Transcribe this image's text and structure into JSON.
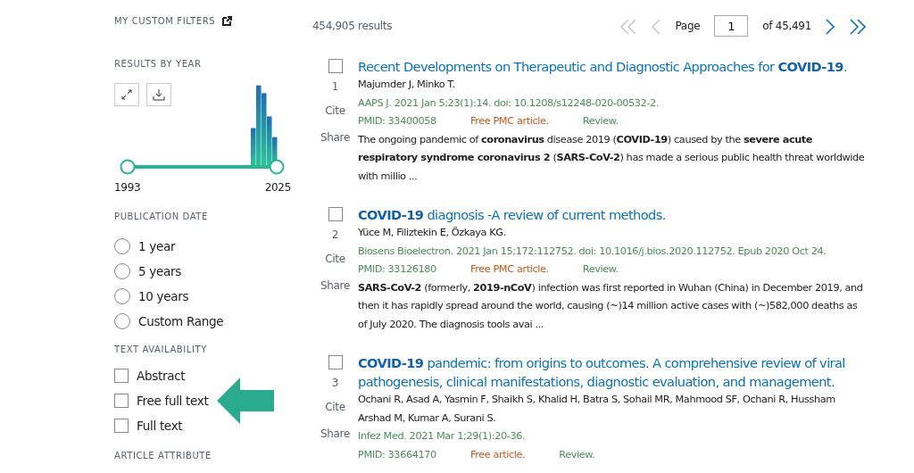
{
  "sidebar": {
    "custom_filters": {
      "label": "MY CUSTOM FILTERS"
    },
    "results_by_year": {
      "label": "RESULTS BY YEAR",
      "start_year": "1993",
      "end_year": "2025"
    },
    "publication_date": {
      "label": "PUBLICATION DATE",
      "options": [
        {
          "label": "1 year",
          "selected": false
        },
        {
          "label": "5 years",
          "selected": false
        },
        {
          "label": "10 years",
          "selected": false
        },
        {
          "label": "Custom Range",
          "selected": false
        }
      ]
    },
    "text_availability": {
      "label": "TEXT AVAILABILITY",
      "options": [
        {
          "label": "Abstract",
          "checked": false
        },
        {
          "label": "Free full text",
          "checked": false,
          "pointed": true
        },
        {
          "label": "Full text",
          "checked": false
        }
      ]
    },
    "article_attribute": {
      "label": "ARTICLE ATTRIBUTE"
    }
  },
  "results_count": "454,905 results",
  "pagination": {
    "first": {
      "disabled": true
    },
    "prev": {
      "disabled": true
    },
    "page_label": "Page",
    "page_value": "1",
    "of_label": "of 45,491",
    "next": {
      "disabled": false
    },
    "last": {
      "disabled": false
    }
  },
  "results": [
    {
      "number": "1",
      "checked": false,
      "title": "Recent Developments on Therapeutic and Diagnostic Approaches for **COVID-19**.",
      "authors": "Majumder J, Minko T.",
      "citation": "AAPS J. 2021 Jan 5;23(1):14. doi: 10.1208/s12248-020-00532-2.",
      "pmid": "PMID: 33400058",
      "free": "Free PMC article.",
      "type": "Review.",
      "cite": "Cite",
      "share": "Share",
      "snippet": "The ongoing pandemic of **coronavirus** disease 2019 (**COVID-19**) caused by the **severe acute respiratory syndrome coronavirus 2** (**SARS-CoV-2**) has made a serious public health threat worldwide with millio ..."
    },
    {
      "number": "2",
      "checked": false,
      "title": "**COVID-19** diagnosis -A review of current methods.",
      "authors": "Yüce M, Filiztekin E, Özkaya KG.",
      "citation": "Biosens Bioelectron. 2021 Jan 15;172:112752. doi: 10.1016/j.bios.2020.112752. Epub 2020 Oct 24.",
      "pmid": "PMID: 33126180",
      "free": "Free PMC article.",
      "type": "Review.",
      "cite": "Cite",
      "share": "Share",
      "snippet": "**SARS-CoV-2** (formerly, **2019-nCoV**) infection was first reported in Wuhan (China) in December 2019, and then it has rapidly spread around the world, causing (~)14 million active cases with (~)582,000 deaths as of July 2020. The diagnosis tools avai ..."
    },
    {
      "number": "3",
      "checked": false,
      "title": "**COVID-19** pandemic: from origins to outcomes. A comprehensive review of viral pathogenesis, clinical manifestations, diagnostic evaluation, and management.",
      "authors": "Ochani R, Asad A, Yasmin F, Shaikh S, Khalid H, Batra S, Sohail MR, Mahmood SF, Ochani R, Hussham Arshad M, Kumar A, Surani S.",
      "citation": "Infez Med. 2021 Mar 1;29(1):20-36.",
      "pmid": "PMID: 33664170",
      "free": "Free article.",
      "type": "Review.",
      "cite": "Cite",
      "share": "Share"
    }
  ]
}
